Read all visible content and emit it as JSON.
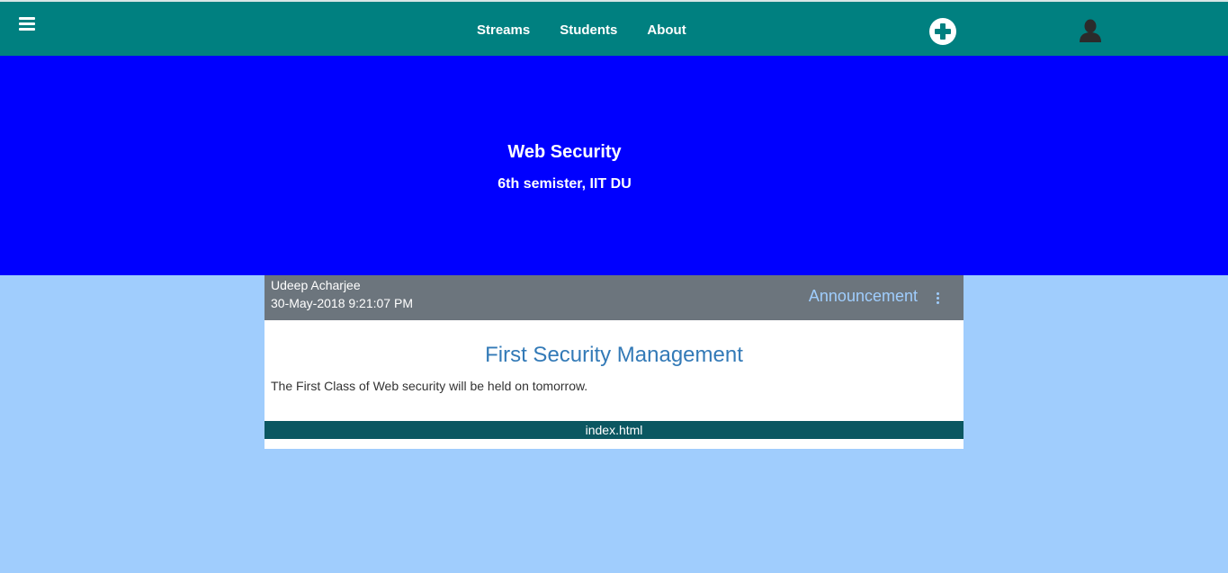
{
  "topbar": {
    "menu_icon": "hamburger-menu-icon",
    "nav": [
      {
        "label": "Streams"
      },
      {
        "label": "Students"
      },
      {
        "label": "About"
      }
    ],
    "add_icon": "plus-circle-icon",
    "user_icon": "user-icon",
    "color": "#008080"
  },
  "banner": {
    "title": "Web Security",
    "subtitle": "6th semister, IIT DU",
    "color": "#0000ff"
  },
  "post": {
    "author": "Udeep Acharjee",
    "date": "30-May-2018 9:21:07 PM",
    "type": "Announcement",
    "menu_icon": "kebab-menu-icon",
    "title": "First Security Management",
    "body": "The First Class of Web security will be held on tomorrow.",
    "attachment": "index.html"
  },
  "page_background": "#a0cdfd"
}
